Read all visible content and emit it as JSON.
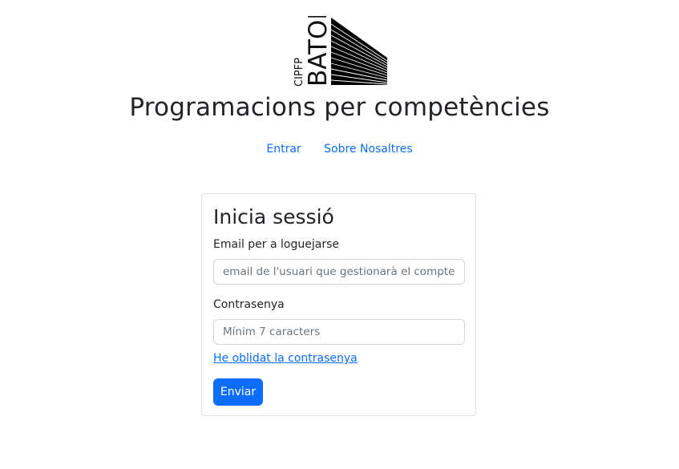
{
  "logo": {
    "text_small": "CIPFP",
    "text_big": "BATOI"
  },
  "header": {
    "title": "Programacions per competències"
  },
  "nav": {
    "items": [
      {
        "label": "Entrar"
      },
      {
        "label": "Sobre Nosaltres"
      }
    ]
  },
  "login": {
    "title": "Inicia sessió",
    "email_label": "Email per a loguejarse",
    "email_placeholder": "email de l'usuari que gestionarà el compte",
    "email_value": "",
    "password_label": "Contrasenya",
    "password_placeholder": "Mínim 7 caracters",
    "password_value": "",
    "forgot_link": "He oblidat la contrasenya",
    "submit_label": "Enviar"
  },
  "colors": {
    "link": "#0d6efd",
    "primary_button": "#0d6efd",
    "text": "#212529",
    "border": "#dee2e6"
  }
}
